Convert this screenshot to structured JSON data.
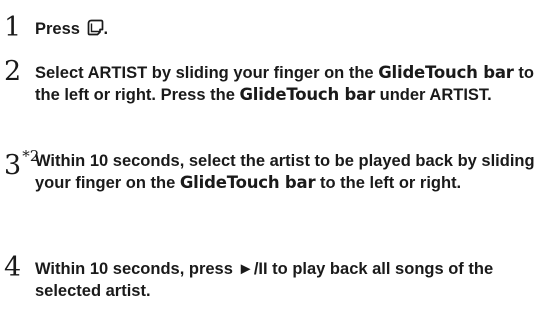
{
  "steps": [
    {
      "number": "1",
      "text_before_icon": "Press ",
      "text_after_icon": ".",
      "icon": "menu-button-icon"
    },
    {
      "number": "2",
      "part1": "Select ARTIST by sliding your finger on the ",
      "emphasis1": "GlideTouch bar",
      "part2": " to the left or right. Press the ",
      "emphasis2": "GlideTouch bar",
      "part3": " under ARTIST."
    },
    {
      "number": "3",
      "superscript": "*2",
      "part1": "Within 10 seconds, select the artist to be played back by sliding your finger on the ",
      "emphasis1": "GlideTouch bar",
      "part2": " to the left or right."
    },
    {
      "number": "4",
      "part1": "Within 10 seconds, press ",
      "button_label": "►/II",
      "part2": " to play back all songs of the selected artist."
    }
  ]
}
